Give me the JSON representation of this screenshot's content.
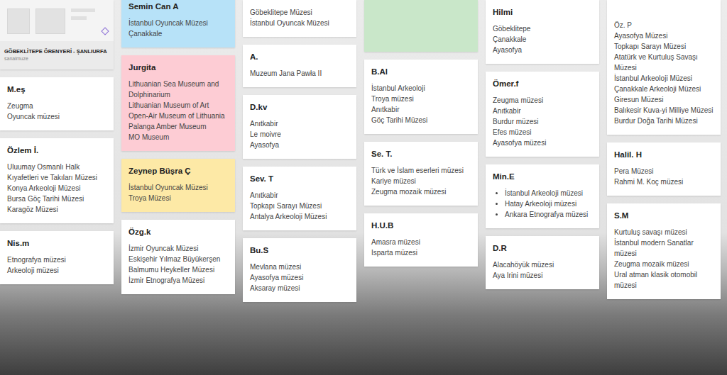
{
  "columns": [
    {
      "cards": [
        {
          "kind": "link",
          "title": "",
          "items": [],
          "caption": "GÖBEKLİTEPE ÖRENYERİ - ŞANLIURFA",
          "source": "sanalmuze",
          "color": "#ebebeb",
          "bullets": false
        },
        {
          "kind": "note",
          "title": "M.eş",
          "items": [
            "Zeugma",
            "Oyuncak  müzesi"
          ],
          "color": "#ffffff",
          "bullets": false
        },
        {
          "kind": "note",
          "title": "Özlem İ.",
          "items": [
            "Uluumay Osmanlı Halk Kıyafetleri ve Takıları Müzesi",
            "Konya Arkeoloji Müzesi",
            "Bursa Göç Tarihi Müzesi",
            "Karagöz Müzesi"
          ],
          "color": "#ffffff",
          "bullets": false
        },
        {
          "kind": "note",
          "title": "Nis.m",
          "items": [
            "Etnografya müzesi",
            "Arkeoloji müzesi"
          ],
          "color": "#ffffff",
          "bullets": false
        }
      ]
    },
    {
      "cards": [
        {
          "kind": "note",
          "title": "Semin Can A",
          "items": [
            "İstanbul Oyuncak Müzesi",
            "Çanakkale"
          ],
          "color": "#b7e2f8",
          "bullets": false
        },
        {
          "kind": "note",
          "title": "Jurgita",
          "items": [
            "Lithuanian Sea Museum and Dolphinarium",
            "Lithuanian Museum of Art",
            "Open-Air Museum of Lithuania",
            "Palanga Amber Museum",
            "MO Museum"
          ],
          "color": "#fdccd4",
          "bullets": false
        },
        {
          "kind": "note",
          "title": "Zeynep Büşra Ç",
          "items": [
            "İstanbul Oyuncak Müzesi",
            "Troya Müzesi"
          ],
          "color": "#fde9a6",
          "bullets": false
        },
        {
          "kind": "note",
          "title": "Özg.k",
          "items": [
            "İzmir Oyuncak Müzesi",
            "Eskişehir Yılmaz Büyükerşen",
            "Balmumu Heykeller Müzesi",
            "İzmir Etnografya Müzesi"
          ],
          "color": "#ffffff",
          "bullets": false
        }
      ]
    },
    {
      "cards": [
        {
          "kind": "note",
          "title": "",
          "items": [
            "Göbeklitepe Müzesi",
            "İstanbul Oyuncak Müzesi"
          ],
          "color": "#ffffff",
          "bullets": false
        },
        {
          "kind": "note",
          "title": "A.",
          "items": [
            "Muzeum Jana Pawła II"
          ],
          "color": "#ffffff",
          "bullets": false
        },
        {
          "kind": "note",
          "title": "D.kv",
          "items": [
            "Anıtkabir",
            "Le moivre",
            "Ayasofya"
          ],
          "color": "#ffffff",
          "bullets": false
        },
        {
          "kind": "note",
          "title": "Sev. T",
          "items": [
            "Anıtkabir",
            "Topkapı Sarayı Müzesi",
            "Antalya Arkeoloji Müzesi"
          ],
          "color": "#ffffff",
          "bullets": false
        },
        {
          "kind": "note",
          "title": "Bu.S",
          "items": [
            "Mevlana müzesi",
            "Ayasofya müzesi",
            "Aksaray müzesi"
          ],
          "color": "#ffffff",
          "bullets": false
        }
      ]
    },
    {
      "cards": [
        {
          "kind": "note",
          "title": "",
          "items": [],
          "color": "#c9e7c9",
          "bullets": false
        },
        {
          "kind": "note",
          "title": "B.Al",
          "items": [
            "İstanbul Arkeoloji",
            "Troya müzesi",
            "Anıtkabir",
            "Göç Tarihi Müzesi"
          ],
          "color": "#ffffff",
          "bullets": false
        },
        {
          "kind": "note",
          "title": "Se. T.",
          "items": [
            "Türk ve İslam eserleri müzesi",
            "Kariye müzesi",
            "Zeugma mozaik müzesi"
          ],
          "color": "#ffffff",
          "bullets": false
        },
        {
          "kind": "note",
          "title": "H.U.B",
          "items": [
            "Amasra müzesi",
            "Isparta müzesi"
          ],
          "color": "#ffffff",
          "bullets": false
        }
      ]
    },
    {
      "cards": [
        {
          "kind": "note",
          "title": "Hilmi",
          "items": [
            "Göbeklitepe",
            "Çanakkale",
            "Ayasofya"
          ],
          "color": "#ffffff",
          "bullets": false
        },
        {
          "kind": "note",
          "title": "Ömer.f",
          "items": [
            "Zeugma müzesi",
            "Anıtkabir",
            "Burdur müzesi",
            "Efes müzesi",
            "Ayasofya müzesi"
          ],
          "color": "#ffffff",
          "bullets": false
        },
        {
          "kind": "note",
          "title": "Min.E",
          "items": [
            "İstanbul Arkeoloji müzesi",
            "Hatay Arkeoloji müzesi",
            "Ankara Etnografya müzesi"
          ],
          "color": "#ffffff",
          "bullets": true
        },
        {
          "kind": "note",
          "title": "D.R",
          "items": [
            "Alacahöyük müzesi",
            "Aya Irini müzesi"
          ],
          "color": "#ffffff",
          "bullets": false
        }
      ]
    },
    {
      "cards": [
        {
          "kind": "note",
          "title": "",
          "items": [
            "Öz. P",
            "Ayasofya Müzesi",
            "Topkapı Sarayı Müzesi",
            "Atatürk ve Kurtuluş Savaşı Müzesi",
            "İstanbul Arkeoloji Müzesi",
            "Çanakkale Arkeoloji Müzesi",
            "Giresun Müzesi",
            "Balıkesir Kuva-yi Milliye Müzesi",
            "Burdur Doğa Tarihi Müzesi"
          ],
          "color": "#ffffff",
          "bullets": false
        },
        {
          "kind": "note",
          "title": "Halil. H",
          "items": [
            "Pera Müzesi",
            "Rahmi M. Koç müzesi"
          ],
          "color": "#ffffff",
          "bullets": false
        },
        {
          "kind": "note",
          "title": "S.M",
          "items": [
            "Kurtuluş savaşı müzesi",
            "İstanbul modern Sanatlar müzesi",
            "Zeugma mozaik müzesi",
            "Ural atman klasik otomobil müzesi"
          ],
          "color": "#ffffff",
          "bullets": false
        }
      ]
    }
  ]
}
